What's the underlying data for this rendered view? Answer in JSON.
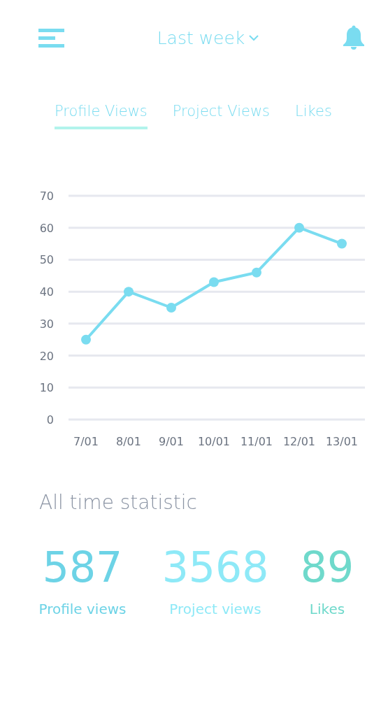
{
  "header": {
    "period": "Last week"
  },
  "tabs": [
    {
      "label": "Profile Views",
      "selected": true
    },
    {
      "label": "Project Views",
      "selected": false
    },
    {
      "label": "Likes",
      "selected": false
    }
  ],
  "chart": {
    "chart_data": {
      "type": "line",
      "categories": [
        "7/01",
        "8/01",
        "9/01",
        "10/01",
        "11/01",
        "12/01",
        "13/01"
      ],
      "series": [
        {
          "color": "#7adcf0",
          "marker": true,
          "values": [
            25,
            40,
            35,
            43,
            46,
            60,
            55
          ]
        }
      ],
      "grid": true,
      "ylim": [
        0,
        70
      ],
      "yticks": [
        0,
        10,
        20,
        30,
        40,
        50,
        60,
        70
      ]
    }
  },
  "statistics": {
    "title": "All time statistic",
    "items": [
      {
        "value": "587",
        "label": "Profile views",
        "color": "#6dd3e6"
      },
      {
        "value": "3568",
        "label": "Project views",
        "color": "#8ee9f7"
      },
      {
        "value": "89",
        "label": "Likes",
        "color": "#6fd9cb"
      }
    ]
  }
}
